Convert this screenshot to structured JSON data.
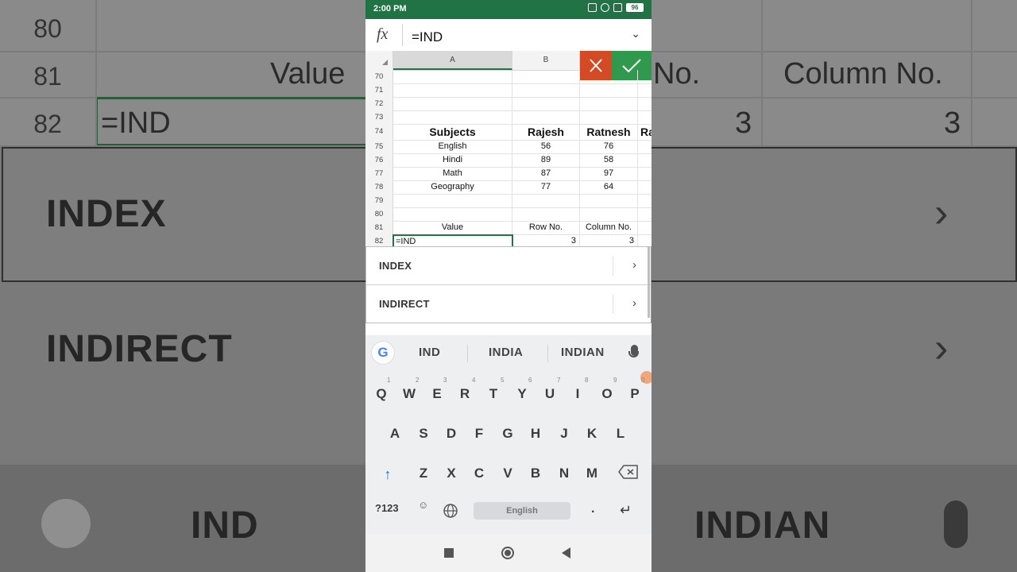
{
  "background": {
    "rows": [
      {
        "num": "80",
        "cells": []
      },
      {
        "num": "81",
        "cells": [
          "Value",
          "No.",
          "Column No."
        ]
      },
      {
        "num": "82",
        "cells": [
          "=IND",
          "3",
          "3"
        ]
      }
    ],
    "suggestions": [
      "INDEX",
      "INDIRECT"
    ],
    "keyboard_suggestions": [
      "IND",
      "INDIAN"
    ]
  },
  "status_bar": {
    "time": "2:00 PM",
    "battery": "96"
  },
  "formula_bar": {
    "fx_label": "fx",
    "value": "=IND"
  },
  "column_headers": [
    "A",
    "B"
  ],
  "sheet": {
    "rows": [
      {
        "num": "70",
        "a": "",
        "b": "",
        "c": ""
      },
      {
        "num": "71",
        "a": "",
        "b": "",
        "c": ""
      },
      {
        "num": "72",
        "a": "",
        "b": "",
        "c": ""
      },
      {
        "num": "73",
        "a": "",
        "b": "",
        "c": ""
      },
      {
        "num": "74",
        "a": "Subjects",
        "b": "Rajesh",
        "c": "Ratnesh",
        "d": "Ra"
      },
      {
        "num": "75",
        "a": "English",
        "b": "56",
        "c": "76"
      },
      {
        "num": "76",
        "a": "Hindi",
        "b": "89",
        "c": "58"
      },
      {
        "num": "77",
        "a": "Math",
        "b": "87",
        "c": "97"
      },
      {
        "num": "78",
        "a": "Geography",
        "b": "77",
        "c": "64"
      },
      {
        "num": "79",
        "a": "",
        "b": "",
        "c": ""
      },
      {
        "num": "80",
        "a": "",
        "b": "",
        "c": ""
      },
      {
        "num": "81",
        "a": "Value",
        "b": "Row No.",
        "c": "Column No."
      },
      {
        "num": "82",
        "a": "=IND",
        "b": "3",
        "c": "3"
      }
    ]
  },
  "autocomplete": [
    {
      "label": "INDEX"
    },
    {
      "label": "INDIRECT"
    }
  ],
  "keyboard": {
    "suggestions": [
      "IND",
      "INDIA",
      "INDIAN"
    ],
    "row1": [
      "Q",
      "W",
      "E",
      "R",
      "T",
      "Y",
      "U",
      "I",
      "O",
      "P"
    ],
    "row1_hints": [
      "1",
      "2",
      "3",
      "4",
      "5",
      "6",
      "7",
      "8",
      "9",
      "0"
    ],
    "row2": [
      "A",
      "S",
      "D",
      "F",
      "G",
      "H",
      "J",
      "K",
      "L"
    ],
    "row3": [
      "Z",
      "X",
      "C",
      "V",
      "B",
      "N",
      "M"
    ],
    "num_key": "?123",
    "space_label": "English",
    "period": "."
  }
}
